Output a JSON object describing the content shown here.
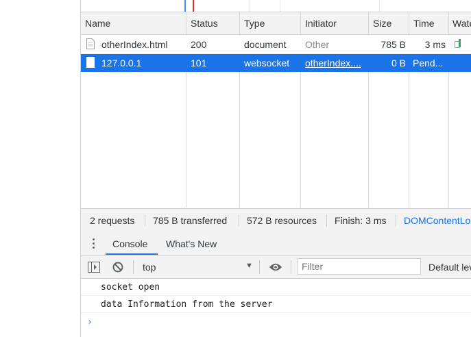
{
  "network": {
    "columns": [
      "Name",
      "Status",
      "Type",
      "Initiator",
      "Size",
      "Time",
      "Waterfall"
    ],
    "rows": [
      {
        "name": "otherIndex.html",
        "status": "200",
        "type": "document",
        "initiator": "Other",
        "size": "785 B",
        "time": "3 ms"
      },
      {
        "name": "127.0.0.1",
        "status": "101",
        "type": "websocket",
        "initiator": "otherIndex....",
        "size": "0 B",
        "time": "Pend..."
      }
    ],
    "selected_row_color": "#1a73e8"
  },
  "summary": {
    "requests": "2 requests",
    "transferred": "785 B transferred",
    "resources": "572 B resources",
    "finish": "Finish: 3 ms",
    "dom_content_loaded": "DOMContentLoaded"
  },
  "drawer": {
    "tabs": [
      {
        "label": "Console",
        "active": true
      },
      {
        "label": "What's New",
        "active": false
      }
    ],
    "menu_icon": "kebab-menu-icon"
  },
  "console_toolbar": {
    "context": "top",
    "filter_placeholder": "Filter",
    "levels": "Default levels",
    "icons": [
      "sidebar-toggle-icon",
      "clear-console-icon",
      "eye-icon"
    ]
  },
  "console_output": {
    "messages": [
      "socket open",
      "data Information from the server"
    ],
    "prompt_symbol": "›"
  },
  "colors": {
    "accent": "#1a73e8",
    "timeline_blue": "#4a8cf7",
    "timeline_red": "#e22f2f",
    "waterfall_green": "#0ec04b"
  }
}
